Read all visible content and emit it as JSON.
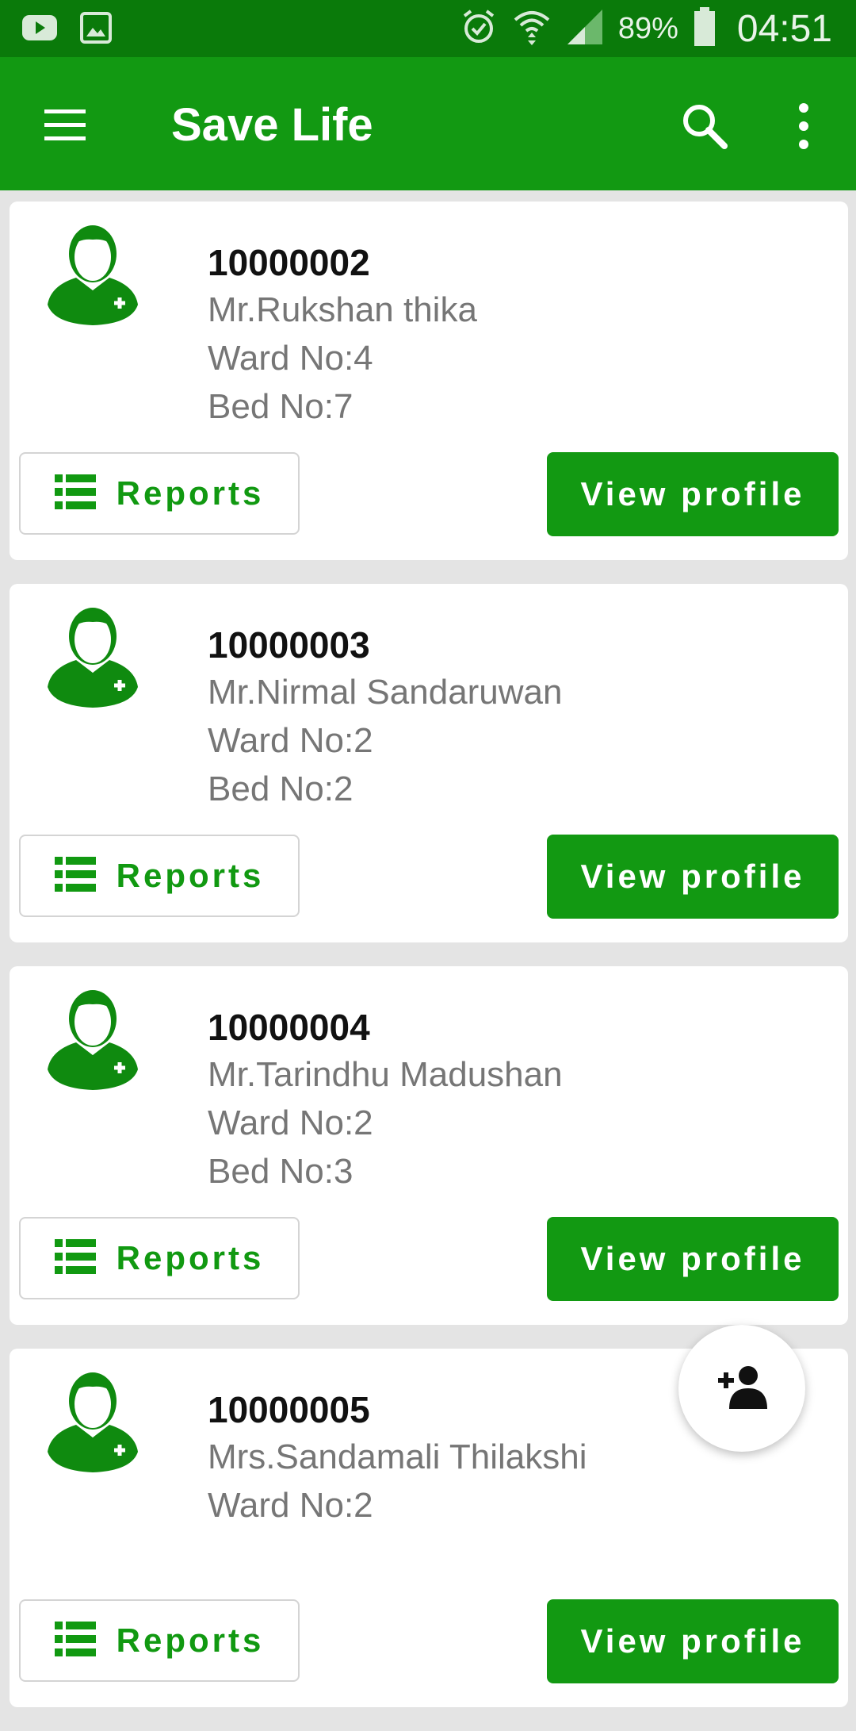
{
  "status_bar": {
    "left_icons": [
      "youtube-icon",
      "gallery-icon"
    ],
    "right_icons": [
      "alarm-icon",
      "wifi-icon",
      "signal-icon",
      "battery-icon"
    ],
    "battery": "89%",
    "time": "04:51"
  },
  "app_bar": {
    "title": "Save Life",
    "icons": [
      "menu-icon",
      "search-icon",
      "more-vert-icon"
    ]
  },
  "theme": {
    "primary": "#129912",
    "status": "#0a7a0a",
    "background": "#e4e4e4",
    "muted_text": "#767676"
  },
  "patients": [
    {
      "id": "10000002",
      "name": "Mr.Rukshan thika",
      "ward": "Ward No:4",
      "bed": "Bed No:7"
    },
    {
      "id": "10000003",
      "name": "Mr.Nirmal Sandaruwan",
      "ward": "Ward No:2",
      "bed": "Bed No:2"
    },
    {
      "id": "10000004",
      "name": "Mr.Tarindhu Madushan",
      "ward": "Ward No:2",
      "bed": "Bed No:3"
    },
    {
      "id": "10000005",
      "name": "Mrs.Sandamali Thilakshi",
      "ward": "Ward No:2",
      "bed": ""
    }
  ],
  "actions": {
    "reports_label": "Reports",
    "view_profile_label": "View profile"
  },
  "fab": {
    "icon": "add-person-icon"
  }
}
